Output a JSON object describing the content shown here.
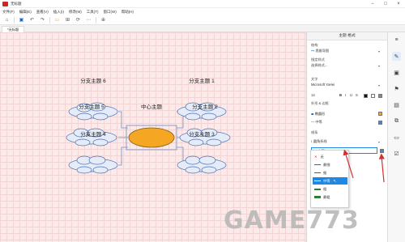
{
  "window": {
    "title": "无标题"
  },
  "menu": [
    "文件(F)",
    "编辑(E)",
    "查看(V)",
    "插入(I)",
    "修改(M)",
    "工具(T)",
    "窗口(W)",
    "帮助(H)"
  ],
  "tab": {
    "label": "*无标题"
  },
  "mindmap": {
    "center": "中心主题",
    "branches": [
      "分支主题 1",
      "分支主题 2",
      "分支主题 3",
      "分支主题 4",
      "分支主题 5",
      "分支主题 6"
    ]
  },
  "panel": {
    "header": "主题 格式",
    "structure_label": "结构",
    "structure_value": "思维导图",
    "theme_style_label": "指定样式",
    "theme_style_value": "选择样式...",
    "text_label": "文字",
    "font_value": "Microsoft YaHei",
    "font_size": "14",
    "shape_label": "外形 & 边框",
    "shape_value": "椭圆形",
    "border_value": "中等",
    "line_label": "线条",
    "line_style_value": "圆角折线",
    "line_width_value": "中等"
  },
  "dropdown": {
    "options": [
      "无",
      "最细",
      "细",
      "中等",
      "粗",
      "最粗"
    ],
    "selected": "中等"
  },
  "watermark": "GAME773.com",
  "colors": {
    "accent": "#1e88e5",
    "center_fill": "#f5a623",
    "cloud_fill": "#e6ecf7",
    "arrow": "#d32f2f"
  }
}
